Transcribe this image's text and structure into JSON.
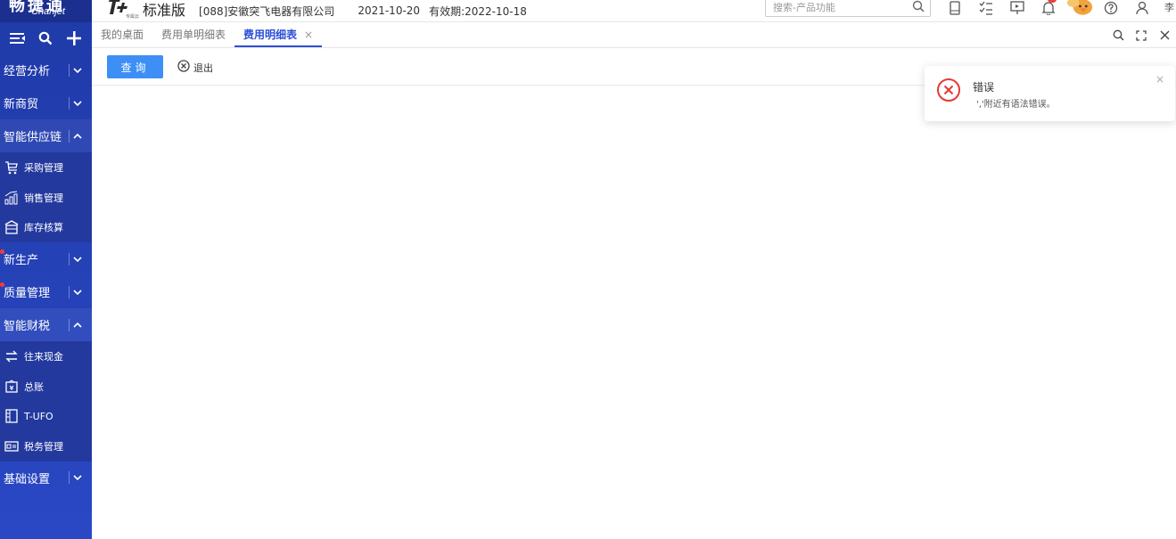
{
  "sidebar": {
    "logo_cn": "畅捷通",
    "logo_en": "Chanjet",
    "groups": [
      {
        "label": "经营分析"
      },
      {
        "label": "新商贸"
      },
      {
        "label": "智能供应链"
      },
      {
        "label": "新生产"
      },
      {
        "label": "质量管理"
      },
      {
        "label": "智能财税"
      },
      {
        "label": "基础设置"
      }
    ],
    "supply_items": [
      {
        "label": "采购管理"
      },
      {
        "label": "销售管理"
      },
      {
        "label": "库存核算"
      }
    ],
    "finance_items": [
      {
        "label": "往来现金"
      },
      {
        "label": "总账"
      },
      {
        "label": "T-UFO"
      },
      {
        "label": "税务管理"
      }
    ]
  },
  "header": {
    "brand_small": "专属云",
    "edition": "标准版",
    "company": "[088]安徽突飞电器有限公司",
    "date": "2021-10-20",
    "validity": "有效期:2022-10-18",
    "search_placeholder": "搜索-产品功能",
    "user_name": "李"
  },
  "tabs": [
    {
      "label": "我的桌面"
    },
    {
      "label": "费用单明细表"
    },
    {
      "label": "费用明细表",
      "close": "×"
    }
  ],
  "toolbar": {
    "query_label": "查询",
    "exit_label": "退出"
  },
  "notification": {
    "title": "错误",
    "message": "','附近有语法错误。",
    "close": "×"
  },
  "colors": {
    "sidebar": "#2440b4",
    "accent": "#2b4fd6",
    "button": "#3d8ff5",
    "error": "#e53935"
  }
}
